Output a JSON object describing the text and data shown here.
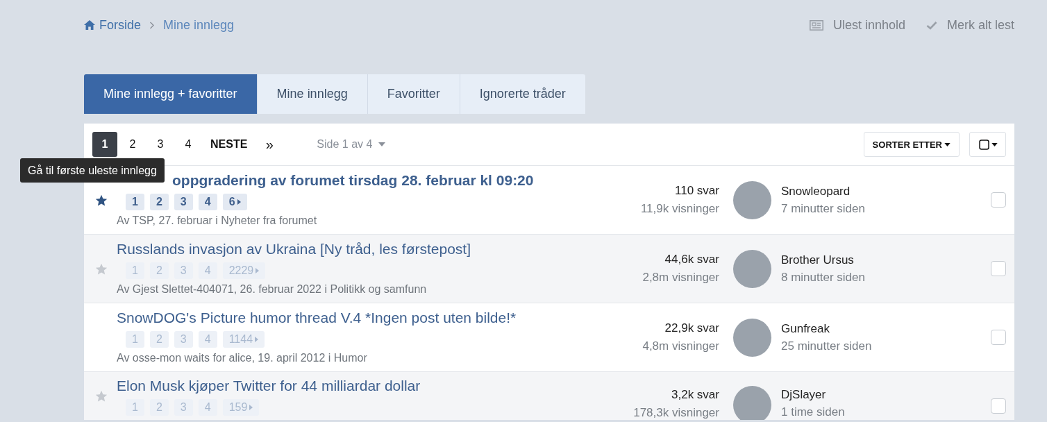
{
  "breadcrumb": [
    {
      "label": "Forside",
      "kind": "home"
    },
    {
      "label": "Mine innlegg",
      "kind": "current"
    }
  ],
  "header_links": [
    {
      "label": "Ulest innhold",
      "kind": "unread"
    },
    {
      "label": "Merk alt lest",
      "kind": "mark"
    }
  ],
  "tabs": [
    {
      "label": "Mine innlegg + favoritter",
      "selected": true
    },
    {
      "label": "Mine innlegg",
      "selected": false
    },
    {
      "label": "Favoritter",
      "selected": false
    },
    {
      "label": "Ignorerte tråder",
      "selected": false
    }
  ],
  "pagination": {
    "pages": [
      {
        "label": "1",
        "selected": true
      },
      {
        "label": "2",
        "selected": false
      },
      {
        "label": "3",
        "selected": false
      },
      {
        "label": "4",
        "selected": false
      }
    ],
    "next": "NESTE",
    "last": "»",
    "page_info": "Side 1 av 4"
  },
  "sort_button": "SORTER ETTER",
  "tooltip": "Gå til første uleste innlegg",
  "threads": [
    {
      "title": "oppgradering av forumet tirsdag 28. februar kl 09:20",
      "covered_by_tooltip": true,
      "unread": true,
      "starred": true,
      "pages": [
        "1",
        "2",
        "3",
        "4",
        "6"
      ],
      "meta": "Av TSP, 27. februar i Nyheter fra forumet",
      "replies": "110 svar",
      "views": "11,9k visninger",
      "last_poster": "Snowleopard",
      "last_time": "7 minutter siden",
      "checked": false
    },
    {
      "title": "Russlands invasjon av Ukraina [Ny tråd, les førstepost]",
      "unread": false,
      "starred": false,
      "pages": [
        "1",
        "2",
        "3",
        "4",
        "2229"
      ],
      "meta": "Av Gjest Slettet-404071, 26. februar 2022 i Politikk og samfunn",
      "replies": "44,6k svar",
      "views": "2,8m visninger",
      "last_poster": "Brother Ursus",
      "last_time": "8 minutter siden",
      "checked": false
    },
    {
      "title": "SnowDOG's Picture humor thread V.4 *Ingen post uten bilde!*",
      "unread": false,
      "pages": [
        "1",
        "2",
        "3",
        "4",
        "1144"
      ],
      "meta": "Av osse-mon waits for alice, 19. april 2012 i Humor",
      "replies": "22,9k svar",
      "views": "4,8m visninger",
      "last_poster": "Gunfreak",
      "last_time": "25 minutter siden",
      "checked": false
    },
    {
      "title": "Elon Musk kjøper Twitter for 44 milliardar dollar",
      "unread": false,
      "starred": false,
      "pages": [
        "1",
        "2",
        "3",
        "4",
        "159"
      ],
      "replies": "3,2k svar",
      "views": "178,3k visninger",
      "last_poster": "DjSlayer",
      "last_time": "1 time siden",
      "checked": false
    }
  ]
}
